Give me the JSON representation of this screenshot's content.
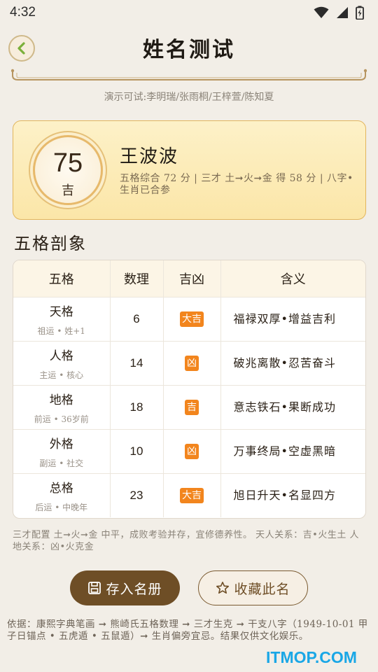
{
  "status": {
    "time": "4:32"
  },
  "header": {
    "title": "姓名测试"
  },
  "demo_hint": "演示可试:李明瑞/张雨桐/王梓萱/陈知夏",
  "score_card": {
    "score": "75",
    "grade": "吉",
    "name": "王波波",
    "summary": "五格综合 72 分 | 三才 土➞火➞金 得 58 分 | 八字•生肖已合参"
  },
  "section_title": "五格剖象",
  "table": {
    "headers": [
      "五格",
      "数理",
      "吉凶",
      "含义"
    ],
    "rows": [
      {
        "name": "天格",
        "sub": "祖运 • 姓+1",
        "num": "6",
        "luck": "大吉",
        "meaning": "福禄双厚•增益吉利"
      },
      {
        "name": "人格",
        "sub": "主运 • 核心",
        "num": "14",
        "luck": "凶",
        "meaning": "破兆离散•忍苦奋斗"
      },
      {
        "name": "地格",
        "sub": "前运 • 36岁前",
        "num": "18",
        "luck": "吉",
        "meaning": "意志铁石•果断成功"
      },
      {
        "name": "外格",
        "sub": "副运 • 社交",
        "num": "10",
        "luck": "凶",
        "meaning": "万事终局•空虚黑暗"
      },
      {
        "name": "总格",
        "sub": "后运 • 中晚年",
        "num": "23",
        "luck": "大吉",
        "meaning": "旭日升天•名显四方"
      }
    ]
  },
  "sancai_note": "三才配置 土➞火➞金 中平，成败考验并存，宜修德养性。 天人关系：吉•火生土 人地关系：凶•火克金",
  "buttons": {
    "save": "存入名册",
    "favorite": "收藏此名"
  },
  "basis_note": "依据：康熙字典笔画 ➞ 熊崎氏五格数理 ➞ 三才生克 ➞ 干支八字（1949-10-01 甲子日锚点 • 五虎遁 • 五鼠遁）➞ 生肖偏旁宜忌。结果仅供文化娱乐。",
  "watermark": "ITMOP.COM",
  "colors": {
    "accent_brown": "#6e4e26",
    "badge_orange": "#f2851d",
    "card_gold": "#fbe6a8"
  }
}
